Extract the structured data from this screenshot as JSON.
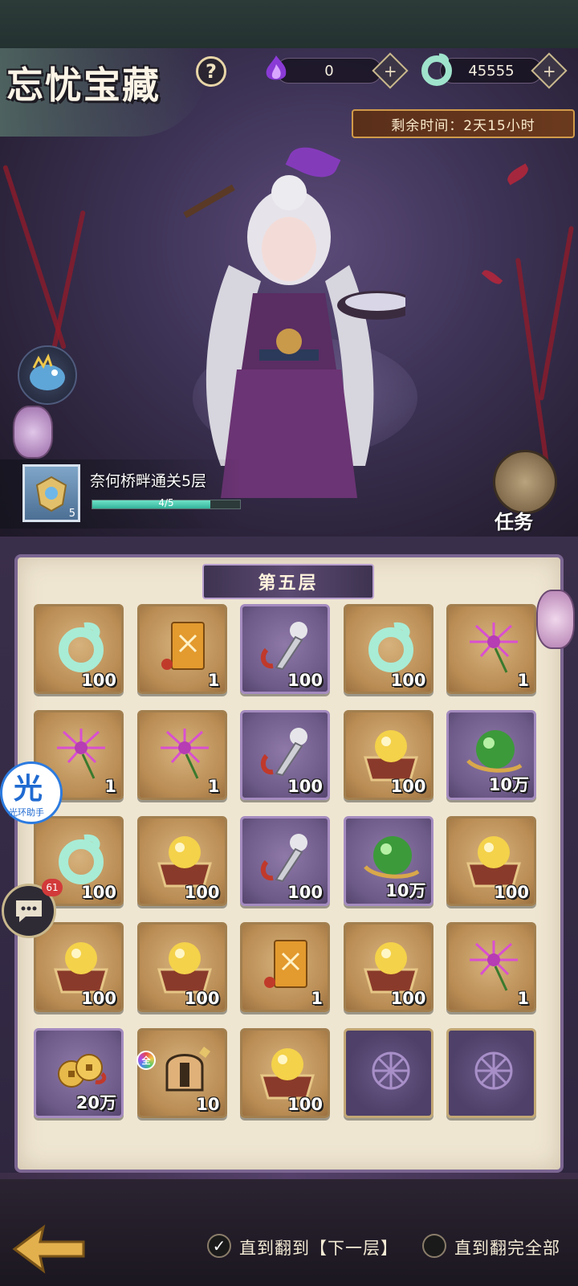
{
  "header": {
    "title": "忘忧宝藏",
    "help_label": "?",
    "currency_spirit": {
      "value": "0",
      "icon": "purple-flame-icon"
    },
    "currency_jade": {
      "value": "45555",
      "icon": "jade-dragon-icon"
    },
    "plus_label": "+",
    "timer": "剩余时间：2天15小时"
  },
  "quest": {
    "text": "奈何桥畔通关5层",
    "level": "5",
    "progress_text": "4/5",
    "progress_fraction": 0.8
  },
  "task_button": {
    "label": "任务"
  },
  "board": {
    "floor_title": "第五层",
    "cells": [
      {
        "type": "jade-dragon",
        "style": "gold",
        "qty": "100"
      },
      {
        "type": "gold-talisman",
        "style": "gold",
        "qty": "1"
      },
      {
        "type": "silver-dagger",
        "style": "purple",
        "qty": "100"
      },
      {
        "type": "jade-dragon",
        "style": "gold",
        "qty": "100"
      },
      {
        "type": "spider-lily",
        "style": "gold",
        "qty": "1"
      },
      {
        "type": "spider-lily",
        "style": "gold",
        "qty": "1"
      },
      {
        "type": "spider-lily",
        "style": "gold",
        "qty": "1"
      },
      {
        "type": "silver-dagger",
        "style": "purple",
        "qty": "100"
      },
      {
        "type": "gold-orb-chest",
        "style": "gold",
        "qty": "100"
      },
      {
        "type": "green-orb",
        "style": "purple",
        "qty": "10万"
      },
      {
        "type": "jade-dragon",
        "style": "gold",
        "qty": "100"
      },
      {
        "type": "gold-orb-chest",
        "style": "gold",
        "qty": "100"
      },
      {
        "type": "silver-dagger",
        "style": "purple",
        "qty": "100"
      },
      {
        "type": "green-orb",
        "style": "purple",
        "qty": "10万"
      },
      {
        "type": "gold-orb-chest",
        "style": "gold",
        "qty": "100"
      },
      {
        "type": "gold-orb-chest",
        "style": "gold",
        "qty": "100"
      },
      {
        "type": "gold-orb-chest",
        "style": "gold",
        "qty": "100"
      },
      {
        "type": "gold-talisman",
        "style": "gold",
        "qty": "1"
      },
      {
        "type": "gold-orb-chest",
        "style": "gold",
        "qty": "100"
      },
      {
        "type": "spider-lily",
        "style": "gold",
        "qty": "1"
      },
      {
        "type": "gold-coins",
        "style": "purple",
        "qty": "20万"
      },
      {
        "type": "helmet-fragment",
        "style": "gold",
        "qty": "10"
      },
      {
        "type": "gold-orb-chest",
        "style": "gold",
        "qty": "100"
      },
      {
        "type": "locked",
        "style": "locked",
        "qty": ""
      },
      {
        "type": "locked",
        "style": "locked",
        "qty": ""
      }
    ],
    "all_badge": "全"
  },
  "helper": {
    "big": "光",
    "small": "光环助手"
  },
  "chat": {
    "count": "61"
  },
  "footer": {
    "option_next": "直到翻到【下一层】",
    "option_all": "直到翻完全部",
    "option_next_checked": true,
    "option_all_checked": false
  },
  "colors": {
    "accent_gold": "#c9b88d",
    "jade": "#9fe3cc",
    "board_bg": "#efe6d2",
    "purple_frame": "#7b6591"
  }
}
